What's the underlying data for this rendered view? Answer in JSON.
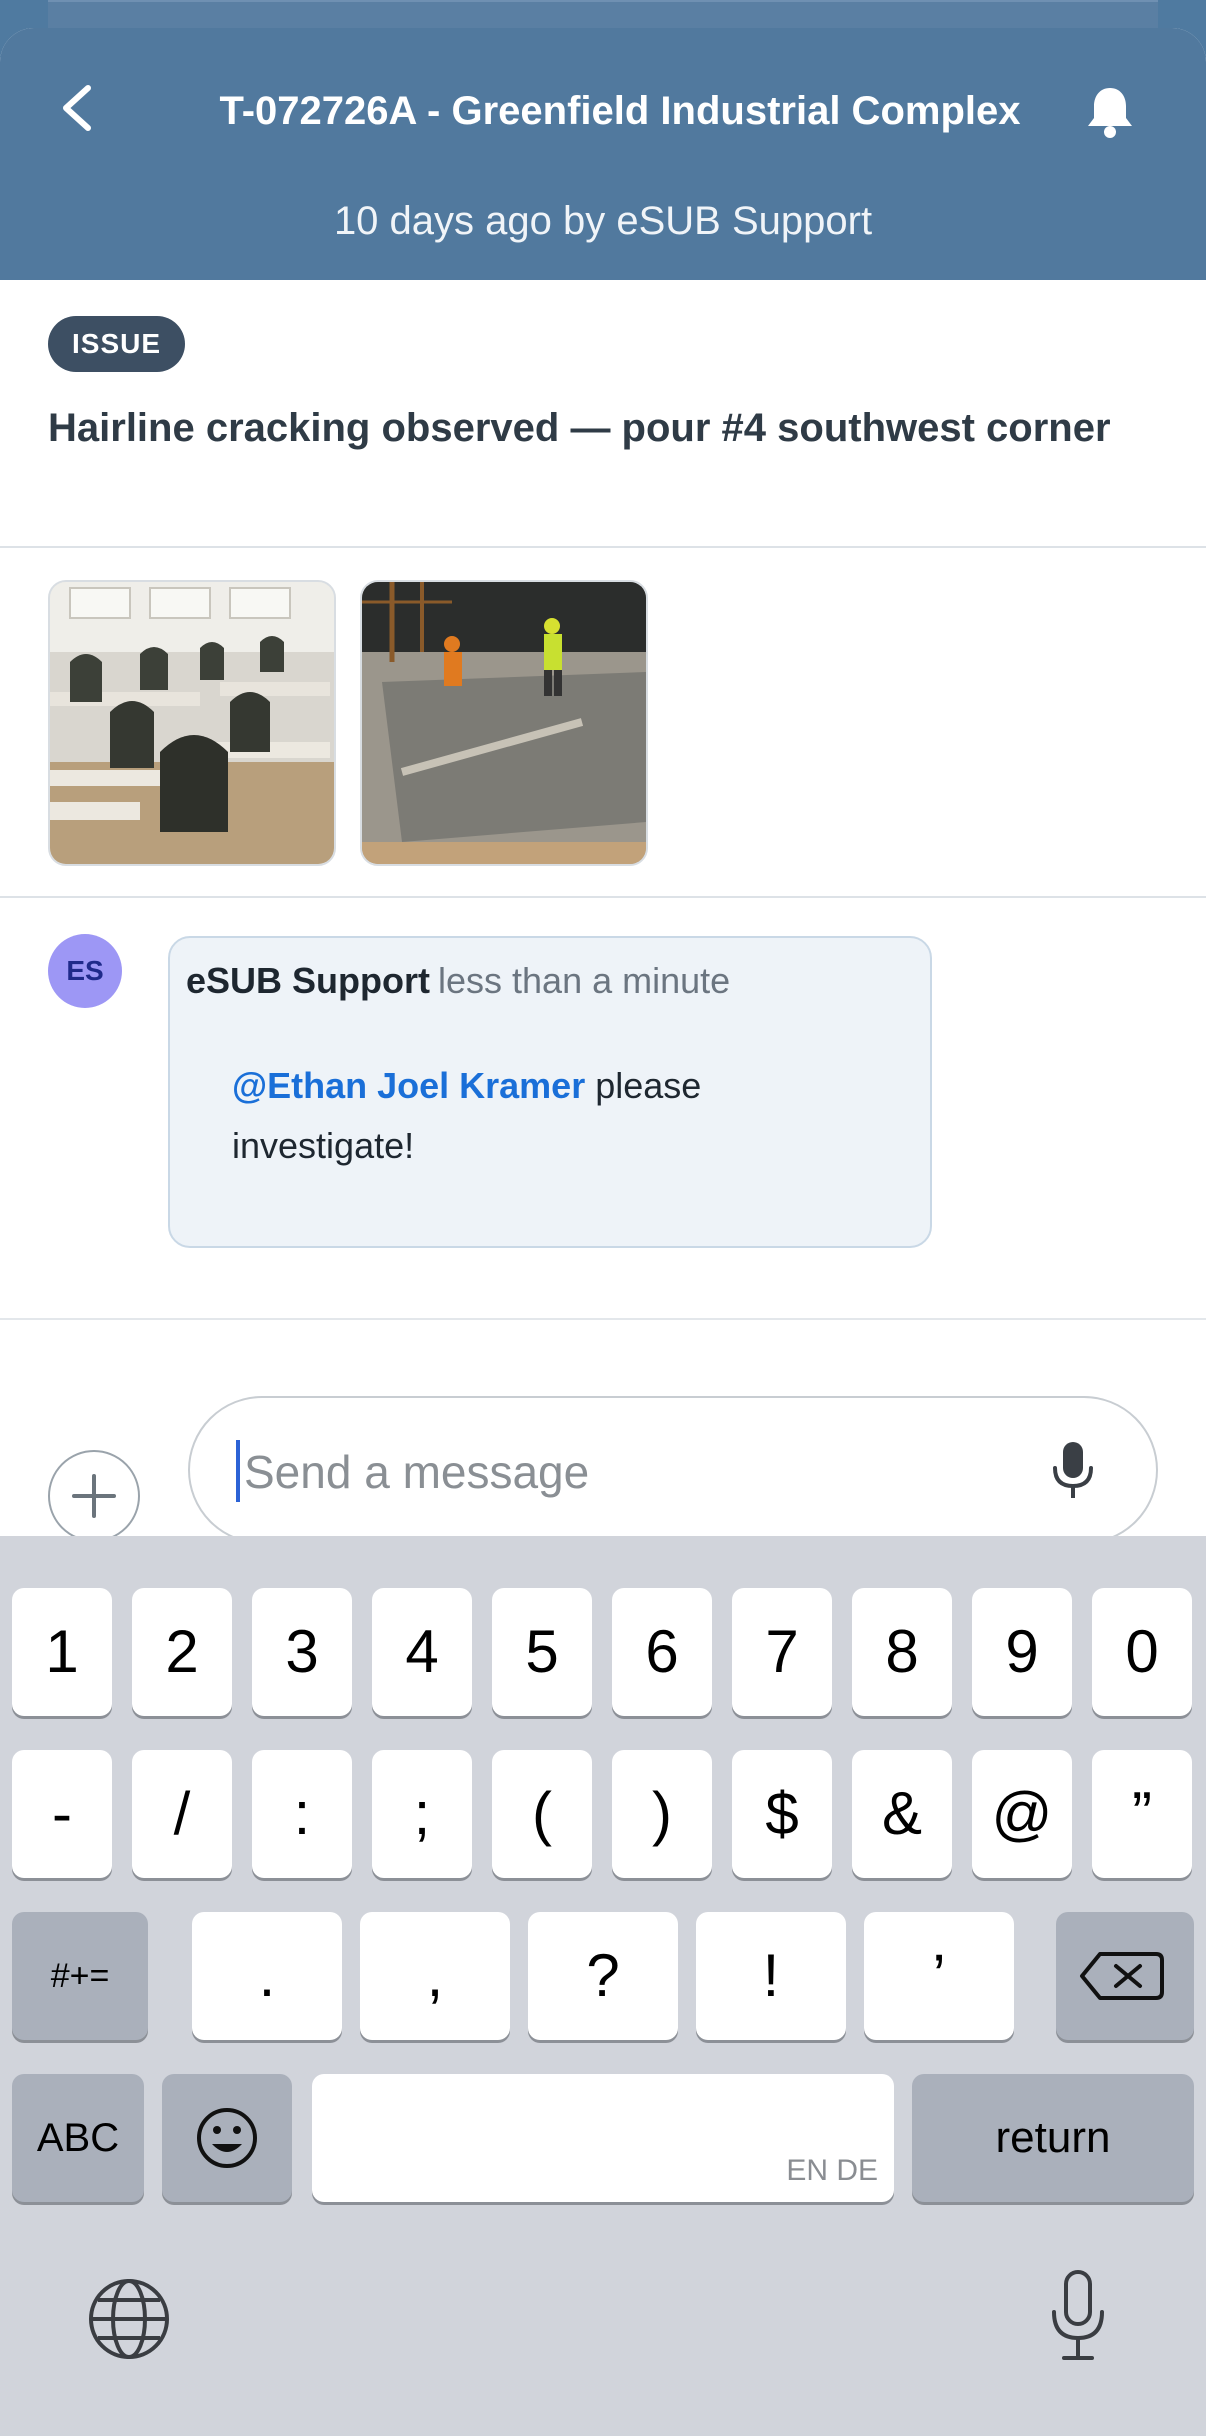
{
  "header": {
    "title": "T-072726A - Greenfield Industrial Complex",
    "subtitle": "10 days ago by eSUB Support",
    "back_icon": "chevron-left-icon",
    "bell_icon": "bell-icon"
  },
  "issue": {
    "badge": "ISSUE",
    "title": "Hairline cracking observed — pour #4 southwest corner"
  },
  "photos": [
    "classroom-photo",
    "concrete-pour-photo"
  ],
  "comment": {
    "avatar_initials": "ES",
    "author": "eSUB Support",
    "time": "less than a minute",
    "mention": "@Ethan Joel Kramer",
    "text": " please investigate!"
  },
  "composer": {
    "placeholder": "Send a message",
    "value": "",
    "add_icon": "plus-icon",
    "mic_icon": "microphone-icon"
  },
  "keyboard": {
    "row1": [
      "1",
      "2",
      "3",
      "4",
      "5",
      "6",
      "7",
      "8",
      "9",
      "0"
    ],
    "row2": [
      "-",
      "/",
      ":",
      ";",
      "(",
      ")",
      "$",
      "&",
      "@",
      "”"
    ],
    "row3_left": "#+=",
    "row3": [
      ".",
      ",",
      "?",
      "!",
      "’"
    ],
    "abc": "ABC",
    "space_lang": "EN DE",
    "return": "return"
  },
  "colors": {
    "header_bg": "#51799e",
    "badge_bg": "#3d4f63",
    "mention": "#1a6fd8",
    "avatar_bg": "#9d97f5"
  }
}
